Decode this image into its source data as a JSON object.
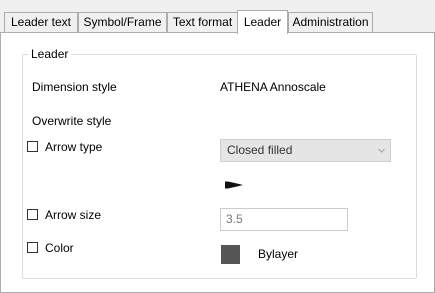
{
  "tabs": [
    {
      "label": "Leader text"
    },
    {
      "label": "Symbol/Frame"
    },
    {
      "label": "Text format"
    },
    {
      "label": "Leader",
      "active": true
    },
    {
      "label": "Administration"
    }
  ],
  "group": {
    "title": "Leader",
    "dimension_style_label": "Dimension style",
    "dimension_style_value": "ATHENA Annoscale",
    "overwrite_style_label": "Overwrite style",
    "arrow_type": {
      "label": "Arrow type",
      "checked": false,
      "value": "Closed filled",
      "icon": "closed-filled-arrow-icon"
    },
    "arrow_size": {
      "label": "Arrow size",
      "checked": false,
      "value": "3.5"
    },
    "color": {
      "label": "Color",
      "checked": false,
      "value": "Bylayer",
      "swatch_color": "#555555"
    }
  }
}
